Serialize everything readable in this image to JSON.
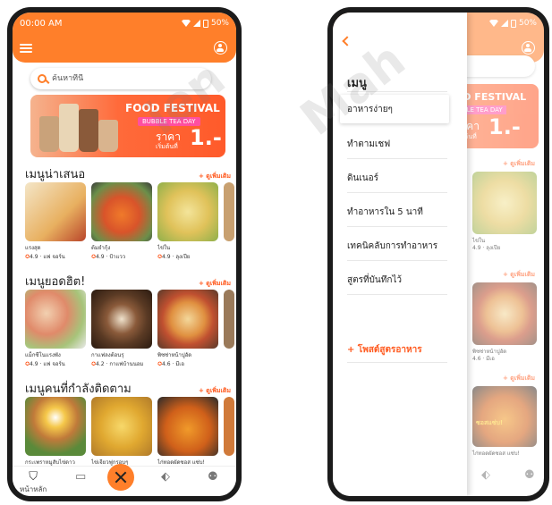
{
  "phone1": {
    "status": {
      "time": "00:00 AM",
      "battery": "50%"
    },
    "search": {
      "placeholder": "ค้นหาที่นี่"
    },
    "banner": {
      "title": "FOOD FESTIVAL",
      "subtitle": "BUBBLE TEA DAY",
      "price_label": "ราคา",
      "price_value": "1.-",
      "price_prefix": "เริ่มต้นที่"
    },
    "sections": [
      {
        "title": "เมนูน่าเสนอ",
        "see_more": "+ ดูเพิ่มเติม",
        "cards": [
          {
            "name": "แรงสุด",
            "rating": "4.9",
            "author": "แฟ จอร์น"
          },
          {
            "name": "ต้มยำกุ้ง",
            "rating": "4.9",
            "author": "ป้าแวว"
          },
          {
            "name": "ไข่ใน",
            "rating": "4.9",
            "author": "ลุงเปีย"
          }
        ]
      },
      {
        "title": "เมนูยอดฮิต!",
        "see_more": "+ ดูเพิ่มเติม",
        "cards": [
          {
            "name": "แม็กซีโนแรงพัง",
            "rating": "4.9",
            "author": "แฟ จอร์น"
          },
          {
            "name": "กาแฟลงต้อนรุ",
            "rating": "4.2",
            "author": "กาแฟบ้านนอม"
          },
          {
            "name": "พิซซ่าหน้าปูอัด",
            "rating": "4.6",
            "author": "มีเอ"
          }
        ]
      },
      {
        "title": "เมนูคนที่กำลังติดตาม",
        "see_more": "+ ดูเพิ่มเติม",
        "cards": [
          {
            "name": "กระเพราหมูสับไข่ดาว",
            "rating": "",
            "author": ""
          },
          {
            "name": "ไข่เจียวฟูกรอบๆ",
            "rating": "",
            "author": ""
          },
          {
            "name": "ไก่ทอดผัดซอส แซ่บ!",
            "rating": "",
            "author": ""
          }
        ]
      }
    ],
    "nav": {
      "home": "หน้าหลัก"
    }
  },
  "phone2": {
    "status": {
      "battery": "50%"
    },
    "drawer": {
      "title": "เมนู",
      "items": [
        "อาหารง่ายๆ",
        "ทำตามเชฟ",
        "ดินเนอร์",
        "ทำอาหารใน 5 นาที",
        "เทคนิคลับการทำอาหาร",
        "สูตรที่บันทึกไว้"
      ],
      "post_recipe": "+ โพสต์สูตรอาหาร"
    },
    "behind": {
      "banner_title": "OD FESTIVAL",
      "banner_sub": "BBLE TEA DAY",
      "banner_price_label": "ราคา",
      "banner_price_prefix": "เริ่มต้นที่",
      "banner_price_value": "1.-",
      "see_more": "+ ดูเพิ่มเติม",
      "card1_name": "ไข่ใน",
      "card1_meta": "4.9 · ลุงเปีย",
      "card2_name": "พิซซ่าหน้าปูอัด",
      "card2_meta": "4.6 · มีเอ",
      "card3_name": "ไก่ทอดผัดซอส แซ่บ!",
      "card3_badge": "ซอสแซ่บ!"
    }
  },
  "watermark": [
    "ien",
    "Mah"
  ],
  "colors": {
    "accent": "#ff7f2a",
    "link": "#ff5a1f"
  }
}
